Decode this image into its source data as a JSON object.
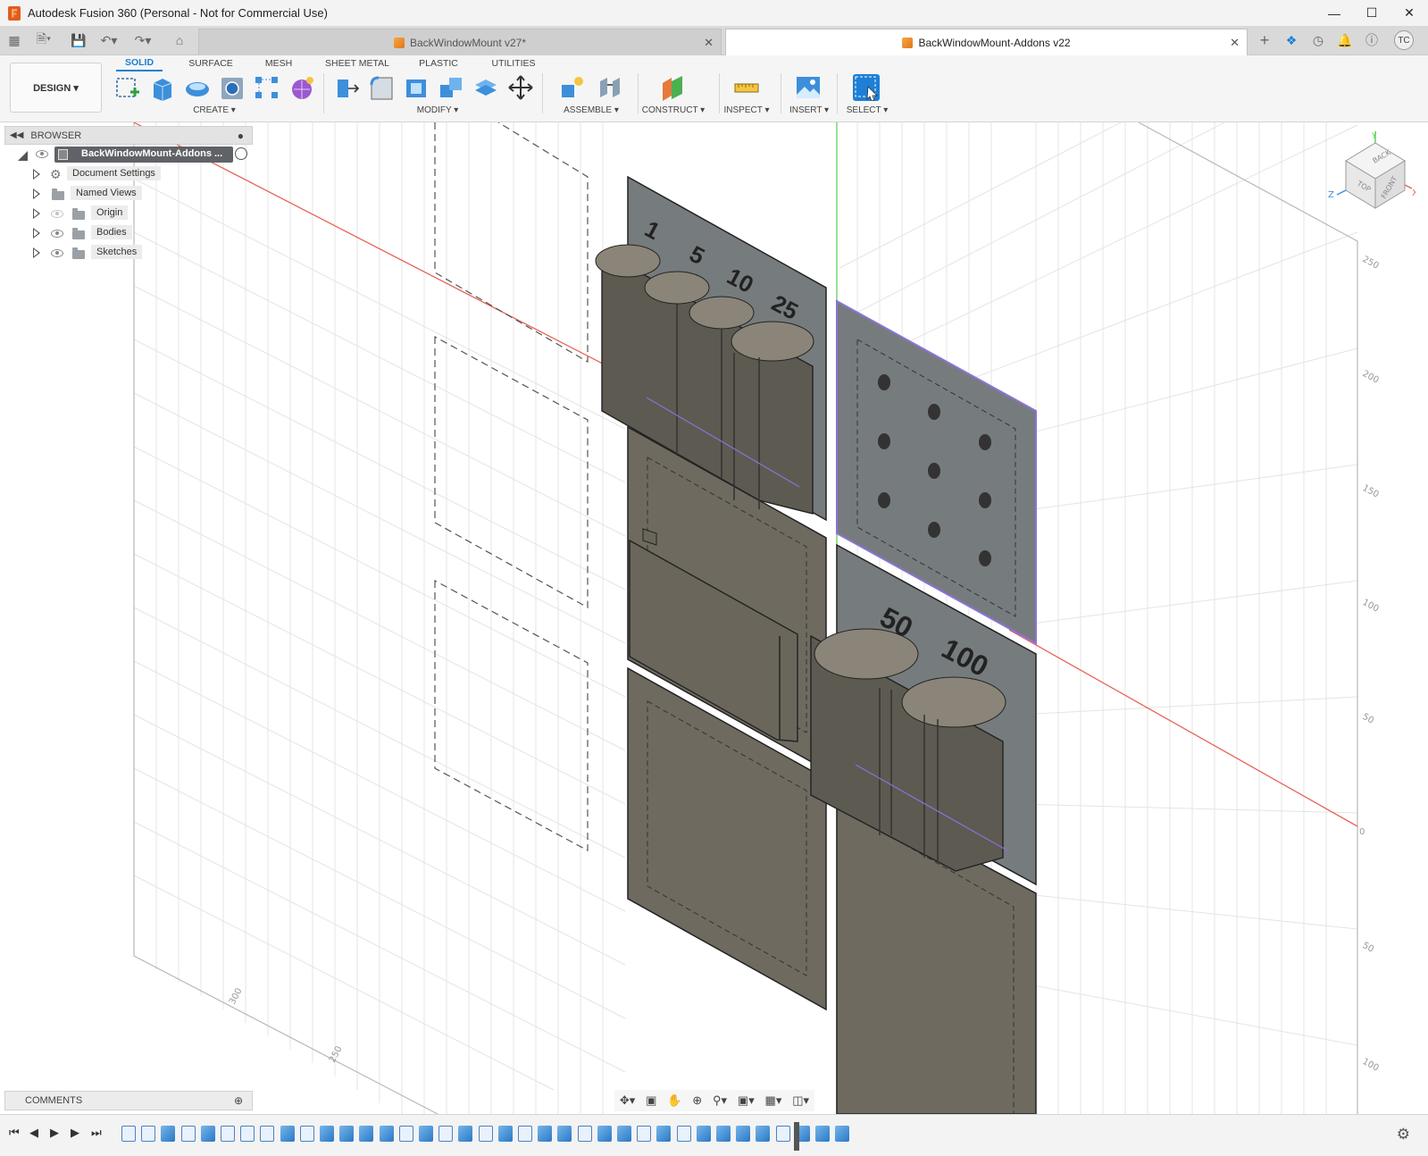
{
  "window": {
    "title": "Autodesk Fusion 360 (Personal - Not for Commercial Use)"
  },
  "doc_tabs": [
    {
      "label": "BackWindowMount v27*",
      "active": false
    },
    {
      "label": "BackWindowMount-Addons v22",
      "active": true
    }
  ],
  "user_initials": "TC",
  "workspace": {
    "label": "DESIGN ▾"
  },
  "workspace_tabs": [
    "SOLID",
    "SURFACE",
    "MESH",
    "SHEET METAL",
    "PLASTIC",
    "UTILITIES"
  ],
  "tool_groups": [
    "CREATE ▾",
    "MODIFY ▾",
    "ASSEMBLE ▾",
    "CONSTRUCT ▾",
    "INSPECT ▾",
    "INSERT ▾",
    "SELECT ▾"
  ],
  "browser": {
    "title": "BROWSER",
    "root": "BackWindowMount-Addons ...",
    "items": [
      "Document Settings",
      "Named Views",
      "Origin",
      "Bodies",
      "Sketches"
    ]
  },
  "comments": {
    "label": "COMMENTS"
  },
  "viewcube": {
    "top": "TOP",
    "front": "FRONT",
    "back": "BACK",
    "axes": [
      "X",
      "Y",
      "Z"
    ]
  },
  "grid_labels_right": [
    "250",
    "200",
    "150",
    "100",
    "50",
    "0",
    "50",
    "100"
  ],
  "grid_labels_bottom": [
    "300",
    "250"
  ],
  "model_text": {
    "coin_labels_top": [
      "1",
      "5",
      "10",
      "25"
    ],
    "coin_labels_bottom": [
      "50",
      "100"
    ]
  },
  "colors": {
    "accent": "#1a7fd4",
    "body_gray": "#6e6a5f",
    "plate_gray": "#767c7e",
    "x_axis": "#e8645a",
    "y_axis": "#5fd15a",
    "selection": "#8a73d6"
  }
}
